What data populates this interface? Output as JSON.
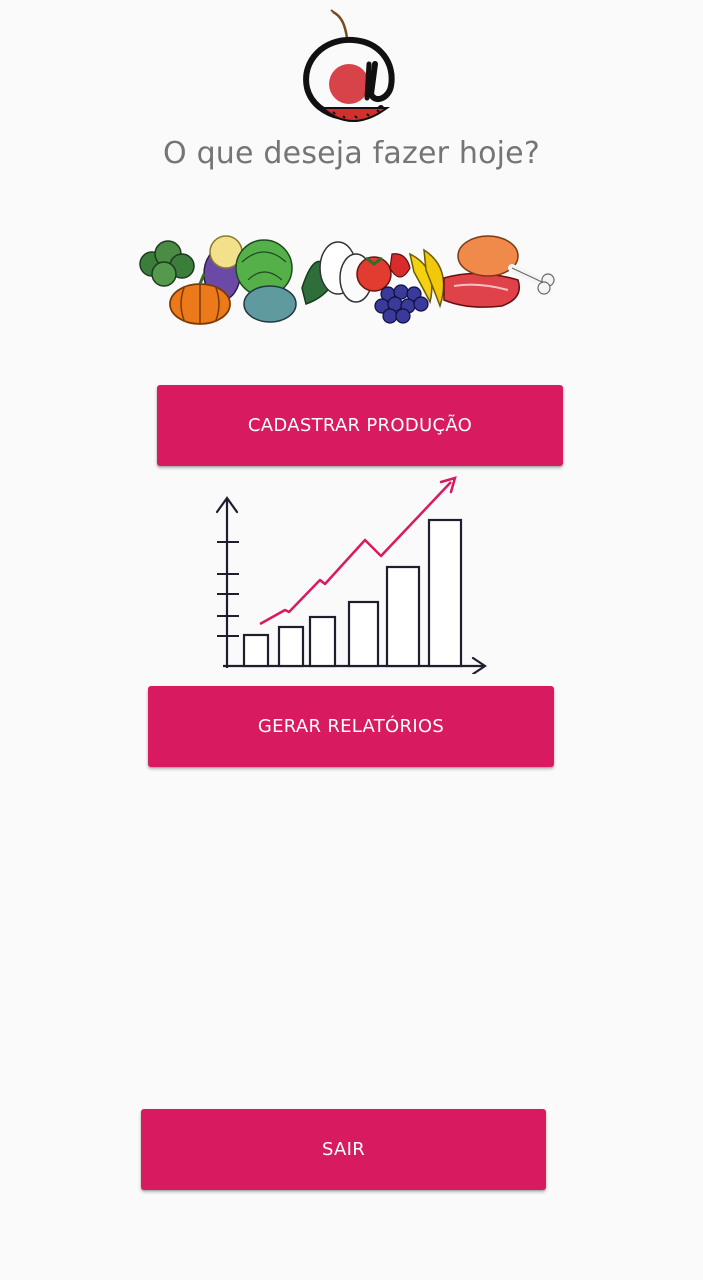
{
  "header": {
    "question": "O que deseja fazer hoje?"
  },
  "actions": {
    "register_production_label": "CADASTRAR PRODUÇÃO",
    "generate_reports_label": "GERAR RELATÓRIOS",
    "exit_label": "SAIR"
  },
  "illustrations": {
    "logo_icon": "cherry-at-logo",
    "food_icon": "vegetables-fruits-meat",
    "chart_icon": "growth-bar-chart"
  },
  "colors": {
    "primary": "#d81b60",
    "background": "#fafafa",
    "headline_text": "#757575",
    "button_text": "#ffffff"
  }
}
